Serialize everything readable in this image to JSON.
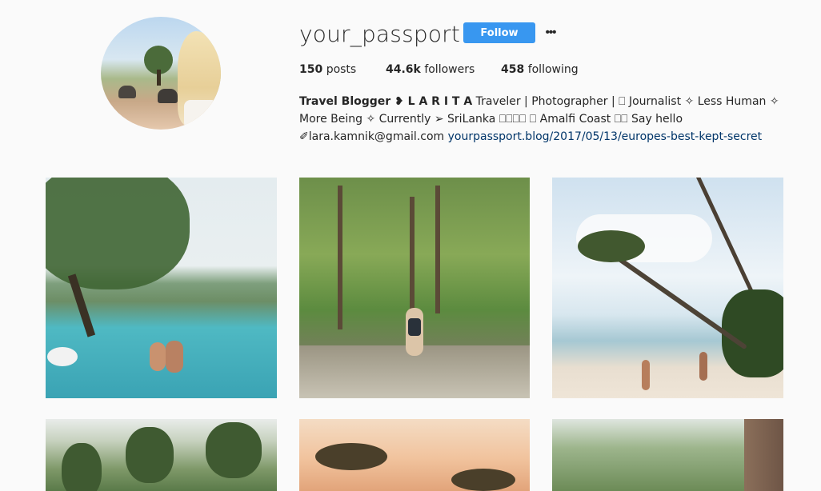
{
  "profile": {
    "username": "your_passport",
    "follow_label": "Follow",
    "more_label": "•••",
    "stats": {
      "posts_count": "150",
      "posts_label": "posts",
      "followers_count": "44.6k",
      "followers_label": "followers",
      "following_count": "458",
      "following_label": "following"
    },
    "bio": {
      "name": "Travel Blogger ❥ L A R I T A",
      "text": " Traveler | Photographer | ⎕ Journalist ✧ Less Human ✧ More Being ✧ Currently ➢ SriLanka ⎕⎕⎕⎕ ⎕ Amalfi Coast ⎕⎕ Say hello ✐lara.kamnik@gmail.com ",
      "link": "yourpassport.blog/2017/05/13/europes-best-kept-secret"
    }
  },
  "posts": [
    {
      "subject": "infinity-pool-couple"
    },
    {
      "subject": "tea-plantation-walker"
    },
    {
      "subject": "beach-palm-tree"
    },
    {
      "subject": "forest-trees"
    },
    {
      "subject": "sunset-trees"
    },
    {
      "subject": "jungle-window"
    }
  ],
  "colors": {
    "follow_button": "#3897f0",
    "link": "#003569",
    "background": "#fafafa",
    "text": "#262626"
  }
}
